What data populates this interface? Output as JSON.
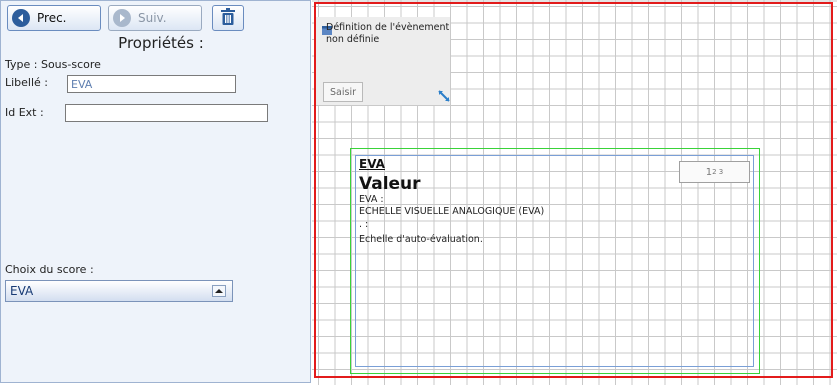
{
  "toolbar": {
    "prev_label": "Prec.",
    "next_label": "Suiv."
  },
  "properties": {
    "title": "Propriétés :",
    "type_label": "Type : Sous-score",
    "libelle_label": "Libellé :",
    "libelle_value": "EVA",
    "idext_label": "Id Ext :",
    "idext_value": ""
  },
  "score_selector": {
    "label": "Choix du score :",
    "selected": "EVA"
  },
  "event_box": {
    "text": "Définition de l'évènement non définie",
    "saisir_label": "Saisir"
  },
  "score_card": {
    "name": "EVA",
    "value_title": "Valeur",
    "line_1": "EVA :",
    "line_2": "ECHELLE VISUELLE ANALOGIQUE (EVA)",
    "line_3": ". :",
    "line_4": "Echelle d'auto-évaluation.",
    "superscript_base": "1",
    "superscript_exp": "2 3"
  },
  "colors": {
    "canvas_border": "#e21b1b",
    "outer_frame": "#39d339",
    "inner_frame": "#7a9fd6",
    "accent": "#2c5d9c"
  },
  "icons": {
    "prev": "arrow-left-circle-icon",
    "next": "arrow-right-circle-icon",
    "delete": "trash-icon",
    "event": "event-icon",
    "resize": "resize-icon",
    "dropdown": "chevron-up-icon"
  }
}
